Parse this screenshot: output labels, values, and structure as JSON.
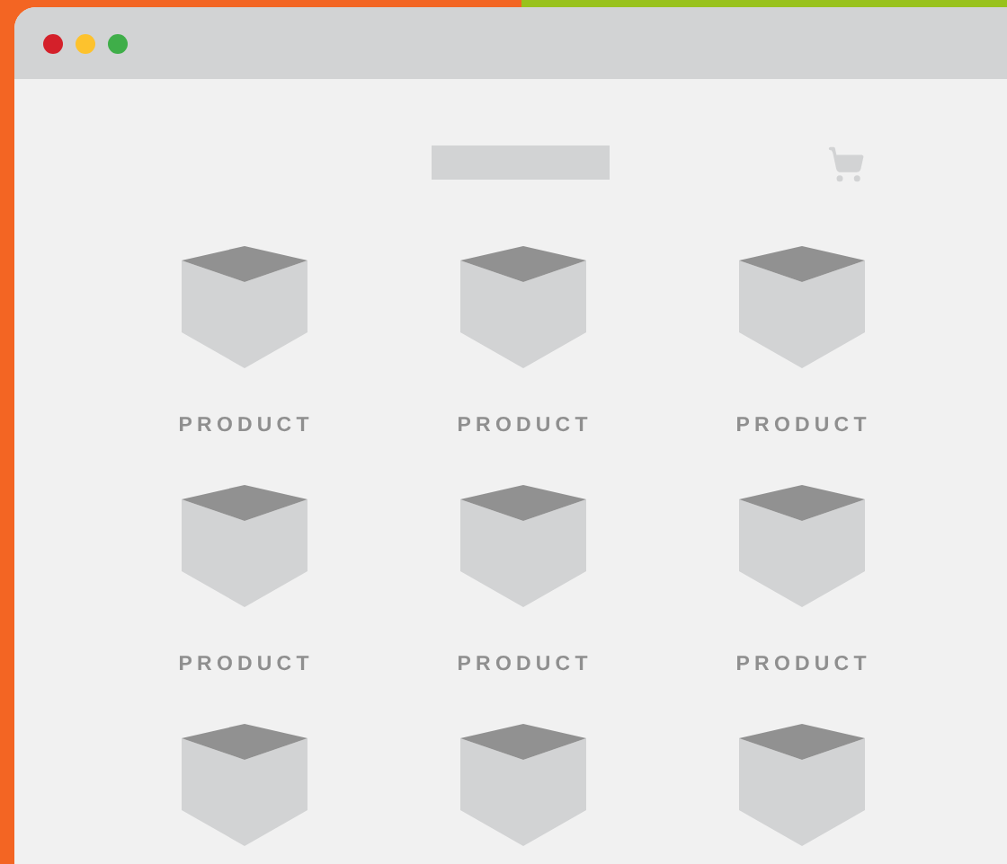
{
  "window": {
    "controls": [
      {
        "color": "#d4202a"
      },
      {
        "color": "#fdc22d"
      },
      {
        "color": "#3fae49"
      }
    ]
  },
  "products": [
    {
      "kind": "labeled",
      "label": "PRODUCT"
    },
    {
      "kind": "labeled",
      "label": "PRODUCT"
    },
    {
      "kind": "labeled",
      "label": "PRODUCT"
    },
    {
      "kind": "labeled",
      "label": "PRODUCT"
    },
    {
      "kind": "labeled",
      "label": "PRODUCT"
    },
    {
      "kind": "labeled",
      "label": "PRODUCT"
    },
    {
      "kind": "cut"
    },
    {
      "kind": "cut"
    },
    {
      "kind": "cut"
    }
  ]
}
